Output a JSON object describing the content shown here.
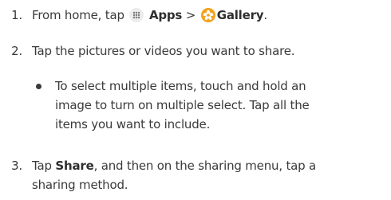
{
  "steps": [
    {
      "number": "1.",
      "prefix": "From home, tap",
      "apps": "Apps",
      "separator": ">",
      "gallery": "Gallery",
      "end": "."
    },
    {
      "number": "2.",
      "line1": "Tap the pictures or videos you want to share."
    },
    {
      "number": "3.",
      "pre": "Tap",
      "bold": "Share",
      "line1_rest": ", and then on the sharing menu, tap a",
      "line2": "sharing method."
    }
  ],
  "substep": {
    "line1": "To select multiple items, touch and hold an",
    "line2": "image to turn on multiple select. Tap all the",
    "line3": "items you want to include."
  },
  "icons": {
    "apps": "apps-grid-icon",
    "gallery": "gallery-flower-icon",
    "gallery_color": "#f4a21c"
  }
}
